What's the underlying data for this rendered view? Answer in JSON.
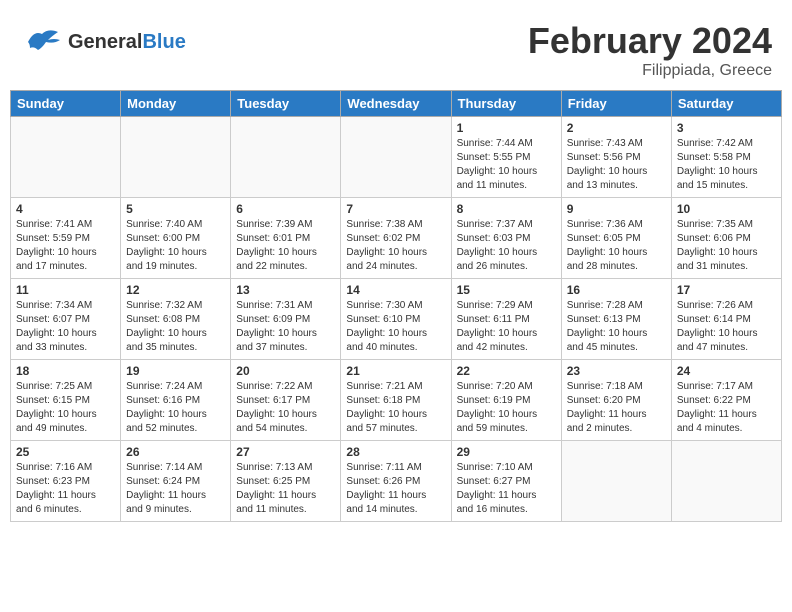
{
  "header": {
    "logo_general": "General",
    "logo_blue": "Blue",
    "month_year": "February 2024",
    "location": "Filippiada, Greece"
  },
  "days_of_week": [
    "Sunday",
    "Monday",
    "Tuesday",
    "Wednesday",
    "Thursday",
    "Friday",
    "Saturday"
  ],
  "weeks": [
    [
      {
        "day": "",
        "info": ""
      },
      {
        "day": "",
        "info": ""
      },
      {
        "day": "",
        "info": ""
      },
      {
        "day": "",
        "info": ""
      },
      {
        "day": "1",
        "info": "Sunrise: 7:44 AM\nSunset: 5:55 PM\nDaylight: 10 hours\nand 11 minutes."
      },
      {
        "day": "2",
        "info": "Sunrise: 7:43 AM\nSunset: 5:56 PM\nDaylight: 10 hours\nand 13 minutes."
      },
      {
        "day": "3",
        "info": "Sunrise: 7:42 AM\nSunset: 5:58 PM\nDaylight: 10 hours\nand 15 minutes."
      }
    ],
    [
      {
        "day": "4",
        "info": "Sunrise: 7:41 AM\nSunset: 5:59 PM\nDaylight: 10 hours\nand 17 minutes."
      },
      {
        "day": "5",
        "info": "Sunrise: 7:40 AM\nSunset: 6:00 PM\nDaylight: 10 hours\nand 19 minutes."
      },
      {
        "day": "6",
        "info": "Sunrise: 7:39 AM\nSunset: 6:01 PM\nDaylight: 10 hours\nand 22 minutes."
      },
      {
        "day": "7",
        "info": "Sunrise: 7:38 AM\nSunset: 6:02 PM\nDaylight: 10 hours\nand 24 minutes."
      },
      {
        "day": "8",
        "info": "Sunrise: 7:37 AM\nSunset: 6:03 PM\nDaylight: 10 hours\nand 26 minutes."
      },
      {
        "day": "9",
        "info": "Sunrise: 7:36 AM\nSunset: 6:05 PM\nDaylight: 10 hours\nand 28 minutes."
      },
      {
        "day": "10",
        "info": "Sunrise: 7:35 AM\nSunset: 6:06 PM\nDaylight: 10 hours\nand 31 minutes."
      }
    ],
    [
      {
        "day": "11",
        "info": "Sunrise: 7:34 AM\nSunset: 6:07 PM\nDaylight: 10 hours\nand 33 minutes."
      },
      {
        "day": "12",
        "info": "Sunrise: 7:32 AM\nSunset: 6:08 PM\nDaylight: 10 hours\nand 35 minutes."
      },
      {
        "day": "13",
        "info": "Sunrise: 7:31 AM\nSunset: 6:09 PM\nDaylight: 10 hours\nand 37 minutes."
      },
      {
        "day": "14",
        "info": "Sunrise: 7:30 AM\nSunset: 6:10 PM\nDaylight: 10 hours\nand 40 minutes."
      },
      {
        "day": "15",
        "info": "Sunrise: 7:29 AM\nSunset: 6:11 PM\nDaylight: 10 hours\nand 42 minutes."
      },
      {
        "day": "16",
        "info": "Sunrise: 7:28 AM\nSunset: 6:13 PM\nDaylight: 10 hours\nand 45 minutes."
      },
      {
        "day": "17",
        "info": "Sunrise: 7:26 AM\nSunset: 6:14 PM\nDaylight: 10 hours\nand 47 minutes."
      }
    ],
    [
      {
        "day": "18",
        "info": "Sunrise: 7:25 AM\nSunset: 6:15 PM\nDaylight: 10 hours\nand 49 minutes."
      },
      {
        "day": "19",
        "info": "Sunrise: 7:24 AM\nSunset: 6:16 PM\nDaylight: 10 hours\nand 52 minutes."
      },
      {
        "day": "20",
        "info": "Sunrise: 7:22 AM\nSunset: 6:17 PM\nDaylight: 10 hours\nand 54 minutes."
      },
      {
        "day": "21",
        "info": "Sunrise: 7:21 AM\nSunset: 6:18 PM\nDaylight: 10 hours\nand 57 minutes."
      },
      {
        "day": "22",
        "info": "Sunrise: 7:20 AM\nSunset: 6:19 PM\nDaylight: 10 hours\nand 59 minutes."
      },
      {
        "day": "23",
        "info": "Sunrise: 7:18 AM\nSunset: 6:20 PM\nDaylight: 11 hours\nand 2 minutes."
      },
      {
        "day": "24",
        "info": "Sunrise: 7:17 AM\nSunset: 6:22 PM\nDaylight: 11 hours\nand 4 minutes."
      }
    ],
    [
      {
        "day": "25",
        "info": "Sunrise: 7:16 AM\nSunset: 6:23 PM\nDaylight: 11 hours\nand 6 minutes."
      },
      {
        "day": "26",
        "info": "Sunrise: 7:14 AM\nSunset: 6:24 PM\nDaylight: 11 hours\nand 9 minutes."
      },
      {
        "day": "27",
        "info": "Sunrise: 7:13 AM\nSunset: 6:25 PM\nDaylight: 11 hours\nand 11 minutes."
      },
      {
        "day": "28",
        "info": "Sunrise: 7:11 AM\nSunset: 6:26 PM\nDaylight: 11 hours\nand 14 minutes."
      },
      {
        "day": "29",
        "info": "Sunrise: 7:10 AM\nSunset: 6:27 PM\nDaylight: 11 hours\nand 16 minutes."
      },
      {
        "day": "",
        "info": ""
      },
      {
        "day": "",
        "info": ""
      }
    ]
  ]
}
